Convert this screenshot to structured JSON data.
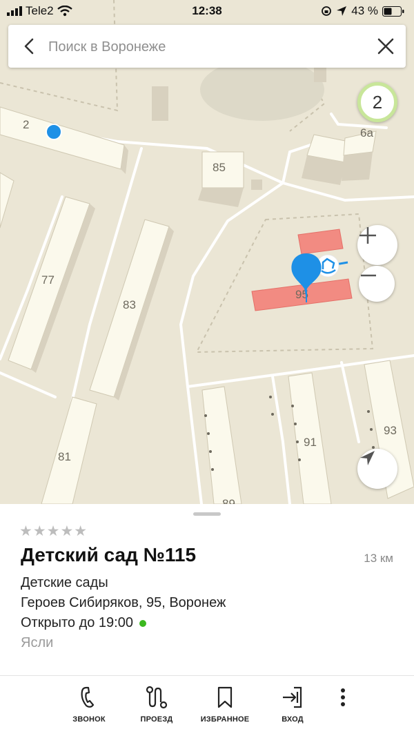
{
  "status_bar": {
    "carrier": "Tele2",
    "time": "12:38",
    "battery": "43 %"
  },
  "search": {
    "placeholder": "Поиск в Воронеже"
  },
  "map": {
    "building_labels": [
      "2",
      "6а",
      "85",
      "77",
      "83",
      "95",
      "81",
      "89",
      "91",
      "93"
    ],
    "cluster_count": "2",
    "highlight_color": "#f28b82",
    "pin_color": "#1e90e6"
  },
  "place": {
    "rating_stars": "★★★★★",
    "title": "Детский сад №115",
    "distance": "13 км",
    "category": "Детские сады",
    "address": "Героев Сибиряков, 95, Воронеж",
    "hours": "Открыто до 19:00",
    "open_status_color": "#3cb81f",
    "subcategory": "Ясли"
  },
  "actions": [
    {
      "icon": "phone-icon",
      "label": "ЗВОНОК"
    },
    {
      "icon": "route-icon",
      "label": "ПРОЕЗД"
    },
    {
      "icon": "bookmark-icon",
      "label": "ИЗБРАННОЕ"
    },
    {
      "icon": "entry-icon",
      "label": "ВХОД"
    },
    {
      "icon": "more-vertical-icon",
      "label": ""
    }
  ]
}
